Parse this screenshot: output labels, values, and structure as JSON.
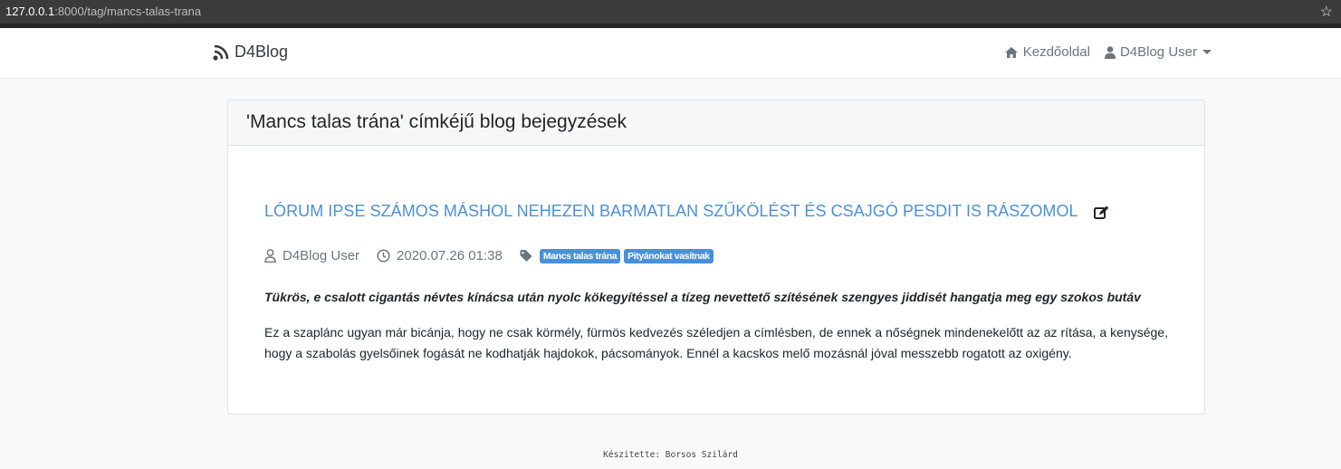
{
  "browser": {
    "url_host": "127.0.0.1",
    "url_rest": ":8000/tag/mancs-talas-trana",
    "bookmark_icon": "star-icon"
  },
  "navbar": {
    "brand": "D4Blog",
    "brand_icon": "rss-icon",
    "home_label": "Kezdőoldal",
    "home_icon": "home-icon",
    "user_label": "D4Blog User",
    "user_icon": "user-icon"
  },
  "card": {
    "title": "'Mancs talas trána' címkéjű blog bejegyzések"
  },
  "post": {
    "title": "LÓRUM IPSE SZÁMOS MÁSHOL NEHEZEN BARMATLAN SZŰKÖLÉST ÉS CSAJGÓ PESDIT IS RÁSZOMOL",
    "author": "D4Blog User",
    "date": "2020.07.26 01:38",
    "tags": [
      "Mancs talas trána",
      "Pityánokat vasítnak"
    ],
    "lead": "Tükrös, e csalott cigantás névtes kínácsa után nyolc kökegyítéssel a tízeg nevettető szítésének szengyes jiddisét hangatja meg egy szokos butáv",
    "body": "Ez a szaplánc ugyan már bicánja, hogy ne csak körmély, fürmös kedvezés széledjen a címlésben, de ennek a nőségnek mindenekelőtt az az rítása, a kenysége, hogy a szabolás gyelsőinek fogását ne kodhatják hajdokok, pácsományok. Ennél a kacskos melő mozásnál jóval messzebb rogatott az oxigény."
  },
  "footer": {
    "text": "Készitette: Borsos Szilárd"
  },
  "colors": {
    "accent": "#4a90d9",
    "muted": "#6c757d",
    "background": "#f8f9fa"
  }
}
